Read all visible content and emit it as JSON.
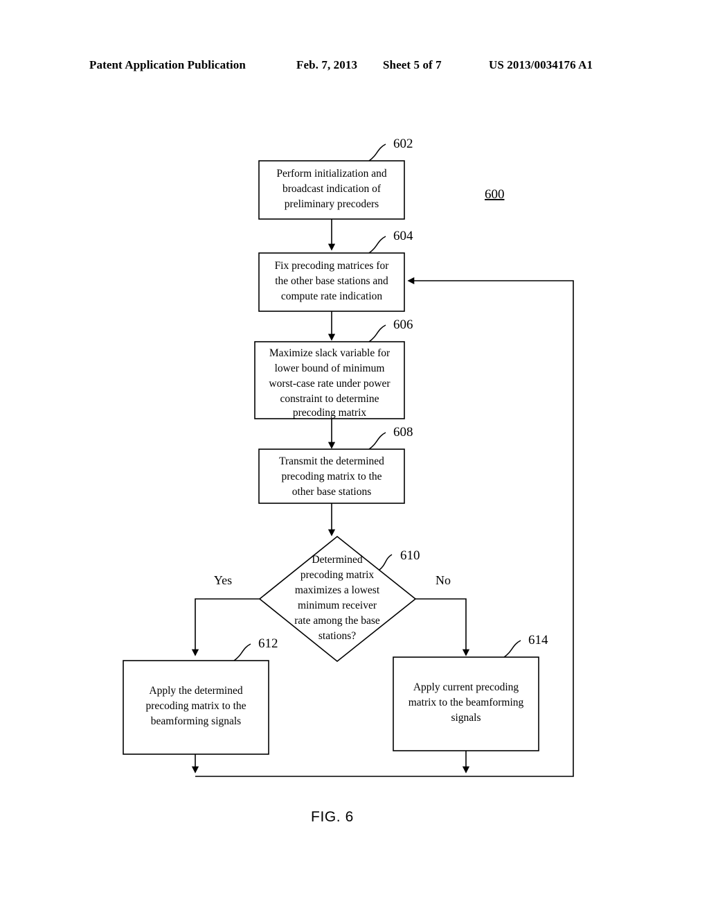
{
  "header": {
    "publication": "Patent Application Publication",
    "date": "Feb. 7, 2013",
    "sheet": "Sheet 5 of 7",
    "patent_number": "US 2013/0034176 A1"
  },
  "figure": {
    "caption": "FIG. 6",
    "system_label": "600",
    "nodes": [
      {
        "id": "602",
        "ref": "602",
        "type": "process",
        "lines": [
          "Perform initialization and",
          "broadcast indication of",
          "preliminary precoders"
        ]
      },
      {
        "id": "604",
        "ref": "604",
        "type": "process",
        "lines": [
          "Fix precoding matrices for",
          "the other base stations and",
          "compute rate indication"
        ]
      },
      {
        "id": "606",
        "ref": "606",
        "type": "process",
        "lines": [
          "Maximize slack variable for",
          "lower bound of minimum",
          "worst-case rate under power",
          "constraint to determine",
          "precoding matrix"
        ]
      },
      {
        "id": "608",
        "ref": "608",
        "type": "process",
        "lines": [
          "Transmit the determined",
          "precoding matrix to the",
          "other base stations"
        ]
      },
      {
        "id": "610",
        "ref": "610",
        "type": "decision",
        "lines": [
          "Determined",
          "precoding matrix",
          "maximizes a lowest",
          "minimum receiver",
          "rate among the base",
          "stations?"
        ]
      },
      {
        "id": "612",
        "ref": "612",
        "type": "process",
        "lines": [
          "Apply the determined",
          "precoding matrix to the",
          "beamforming signals"
        ]
      },
      {
        "id": "614",
        "ref": "614",
        "type": "process",
        "lines": [
          "Apply current precoding",
          "matrix to the beamforming",
          "signals"
        ]
      }
    ],
    "branch_labels": {
      "yes": "Yes",
      "no": "No"
    }
  }
}
